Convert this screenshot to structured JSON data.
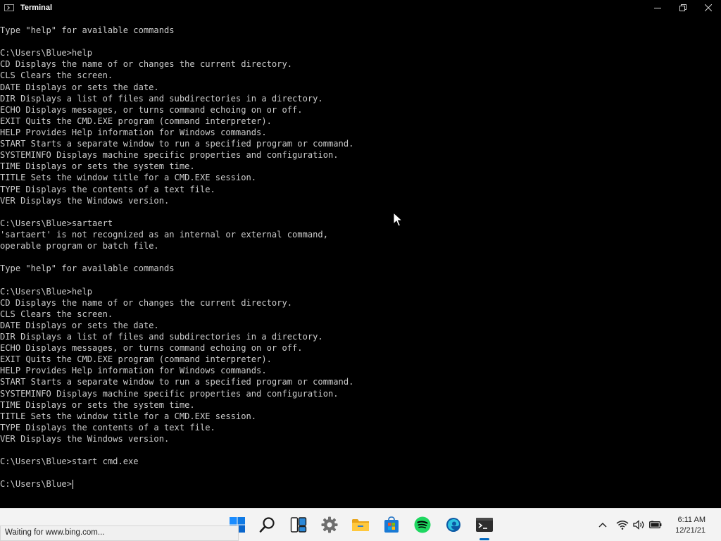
{
  "window": {
    "title": "Terminal",
    "icon": "terminal-icon"
  },
  "console": {
    "lines": [
      "Type \"help\" for available commands",
      "",
      "C:\\Users\\Blue>help",
      "CD Displays the name of or changes the current directory.",
      "CLS Clears the screen.",
      "DATE Displays or sets the date.",
      "DIR Displays a list of files and subdirectories in a directory.",
      "ECHO Displays messages, or turns command echoing on or off.",
      "EXIT Quits the CMD.EXE program (command interpreter).",
      "HELP Provides Help information for Windows commands.",
      "START Starts a separate window to run a specified program or command.",
      "SYSTEMINFO Displays machine specific properties and configuration.",
      "TIME Displays or sets the system time.",
      "TITLE Sets the window title for a CMD.EXE session.",
      "TYPE Displays the contents of a text file.",
      "VER Displays the Windows version.",
      "",
      "C:\\Users\\Blue>sartaert",
      "'sartaert' is not recognized as an internal or external command,",
      "operable program or batch file.",
      "",
      "Type \"help\" for available commands",
      "",
      "C:\\Users\\Blue>help",
      "CD Displays the name of or changes the current directory.",
      "CLS Clears the screen.",
      "DATE Displays or sets the date.",
      "DIR Displays a list of files and subdirectories in a directory.",
      "ECHO Displays messages, or turns command echoing on or off.",
      "EXIT Quits the CMD.EXE program (command interpreter).",
      "HELP Provides Help information for Windows commands.",
      "START Starts a separate window to run a specified program or command.",
      "SYSTEMINFO Displays machine specific properties and configuration.",
      "TIME Displays or sets the system time.",
      "TITLE Sets the window title for a CMD.EXE session.",
      "TYPE Displays the contents of a text file.",
      "VER Displays the Windows version.",
      "",
      "C:\\Users\\Blue>start cmd.exe",
      "",
      "C:\\Users\\Blue>"
    ]
  },
  "taskbar": {
    "apps": [
      {
        "name": "start-icon"
      },
      {
        "name": "search-icon"
      },
      {
        "name": "task-view-icon"
      },
      {
        "name": "settings-icon"
      },
      {
        "name": "file-explorer-icon"
      },
      {
        "name": "microsoft-store-icon"
      },
      {
        "name": "spotify-icon"
      },
      {
        "name": "edge-icon"
      },
      {
        "name": "terminal-icon"
      }
    ],
    "clock": {
      "time": "6:11 AM",
      "date": "12/21/21"
    }
  },
  "status_bar": {
    "text": "Waiting for www.bing.com..."
  },
  "colors": {
    "console_bg": "#000000",
    "console_text": "#cccccc",
    "taskbar_bg": "#f3f3f3",
    "accent": "#0067c0"
  }
}
